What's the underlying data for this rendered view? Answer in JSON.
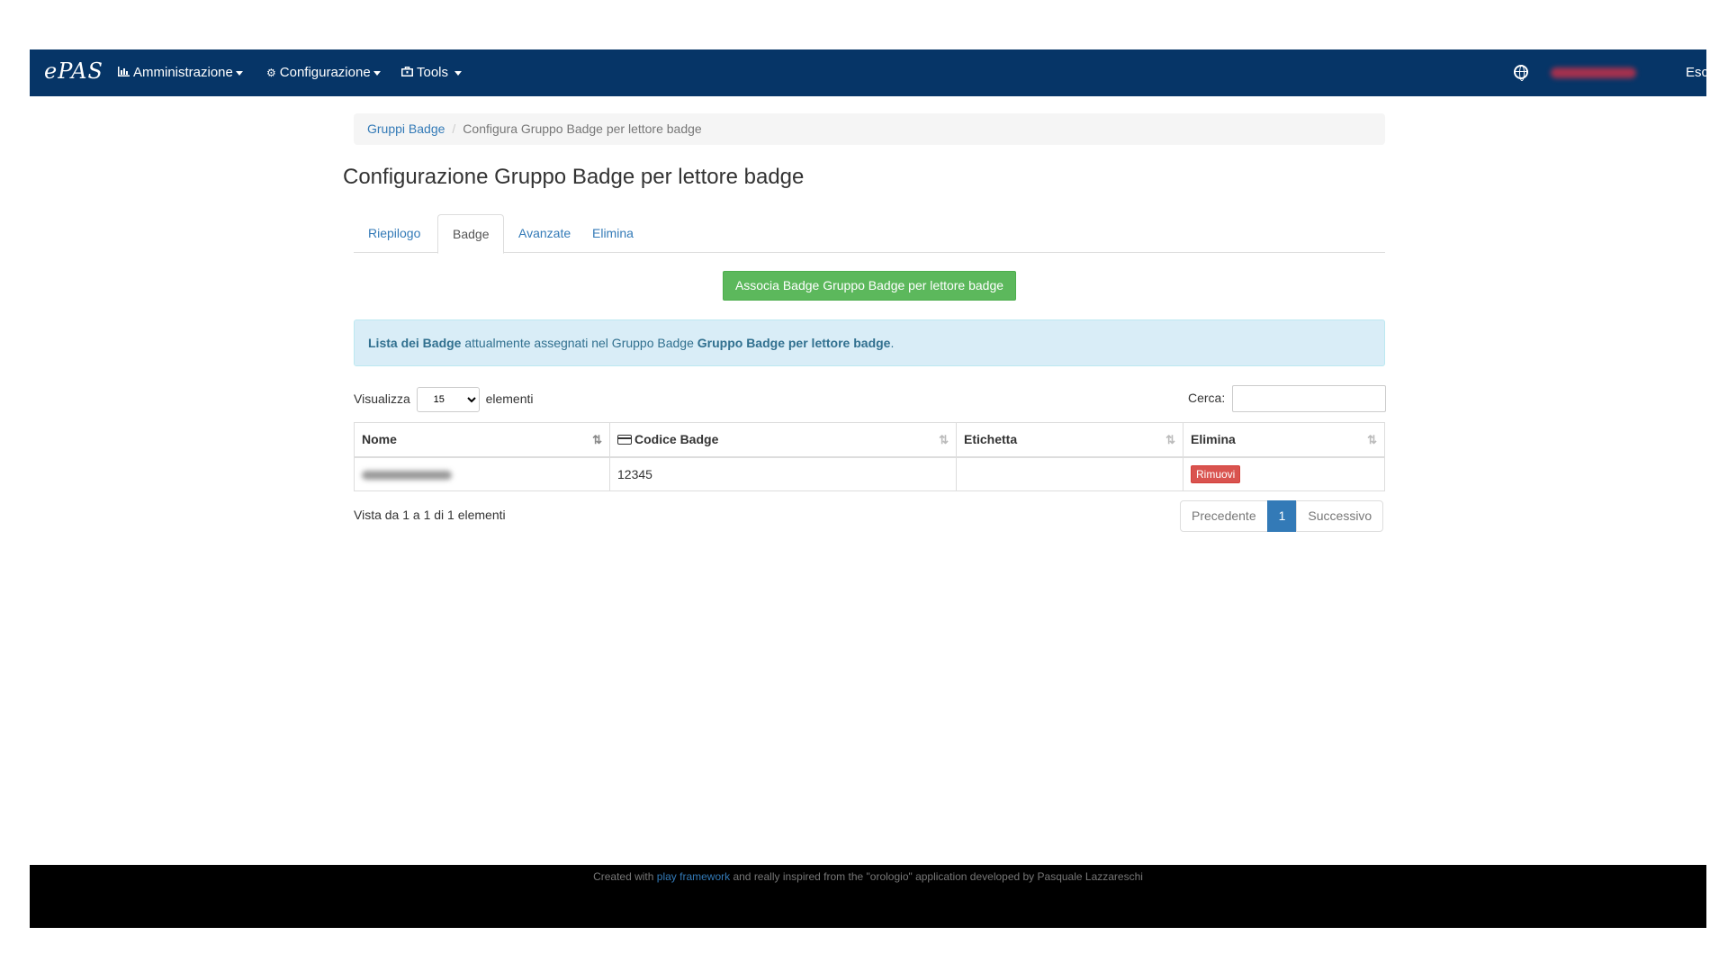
{
  "navbar": {
    "brand": "ePAS",
    "menu": [
      {
        "label": "Amministrazione",
        "icon": "bar-chart-icon"
      },
      {
        "label": "Configurazione",
        "icon": "gear-icon"
      },
      {
        "label": "Tools",
        "icon": "toolbox-icon"
      }
    ],
    "logout_label": "Esci"
  },
  "breadcrumb": {
    "parent": "Gruppi Badge",
    "current": "Configura Gruppo Badge per lettore badge"
  },
  "page_title": "Configurazione Gruppo Badge per lettore badge",
  "tabs": [
    {
      "label": "Riepilogo",
      "active": false
    },
    {
      "label": "Badge",
      "active": true
    },
    {
      "label": "Avanzate",
      "active": false
    },
    {
      "label": "Elimina",
      "active": false
    }
  ],
  "associate_button": "Associa Badge Gruppo Badge per lettore badge",
  "alert": {
    "strong1": "Lista dei Badge",
    "text": " attualmente assegnati nel Gruppo Badge ",
    "strong2": "Gruppo Badge per lettore badge",
    "end": "."
  },
  "length": {
    "prefix": "Visualizza",
    "value": "15",
    "suffix": "elementi"
  },
  "search_label": "Cerca:",
  "table": {
    "columns": [
      "Nome",
      "Codice Badge",
      "Etichetta",
      "Elimina"
    ],
    "rows": [
      {
        "nome": "",
        "codice": "12345",
        "etichetta": "",
        "action": "Rimuovi"
      }
    ]
  },
  "info": "Vista da 1 a 1 di 1 elementi",
  "pagination": {
    "prev": "Precedente",
    "page": "1",
    "next": "Successivo"
  },
  "footer": {
    "prefix": "Created with ",
    "link": "play framework",
    "suffix": " and really inspired from the \"orologio\" application developed by Pasquale Lazzareschi"
  },
  "colors": {
    "navbar": "#063567",
    "primary": "#337ab7",
    "success": "#5cb85c",
    "danger": "#d9534f",
    "info_bg": "#d9edf7"
  }
}
